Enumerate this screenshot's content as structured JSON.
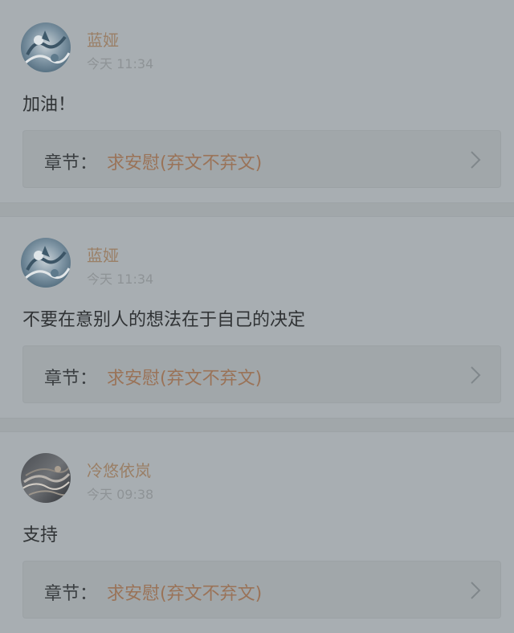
{
  "comments": [
    {
      "username": "蓝娅",
      "time": "今天 11:34",
      "text": "加油！",
      "chapter_prefix": "章节：",
      "chapter_title": "求安慰(弃文不弃文)",
      "avatar": "anime-blue-avatar"
    },
    {
      "username": "蓝娅",
      "time": "今天 11:34",
      "text": "不要在意别人的想法在于自己的决定",
      "chapter_prefix": "章节：",
      "chapter_title": "求安慰(弃文不弃文)",
      "avatar": "anime-blue-avatar"
    },
    {
      "username": "冷悠依岚",
      "time": "今天 09:38",
      "text": "支持",
      "chapter_prefix": "章节：",
      "chapter_title": "求安慰(弃文不弃文)",
      "avatar": "dark-feather-avatar"
    }
  ],
  "colors": {
    "background": "#a8aeb2",
    "username": "#9a7f66",
    "chapter_title": "#9a7358",
    "text": "#303335"
  },
  "icons": {
    "chapter_arrow": "chevron-right-icon"
  }
}
